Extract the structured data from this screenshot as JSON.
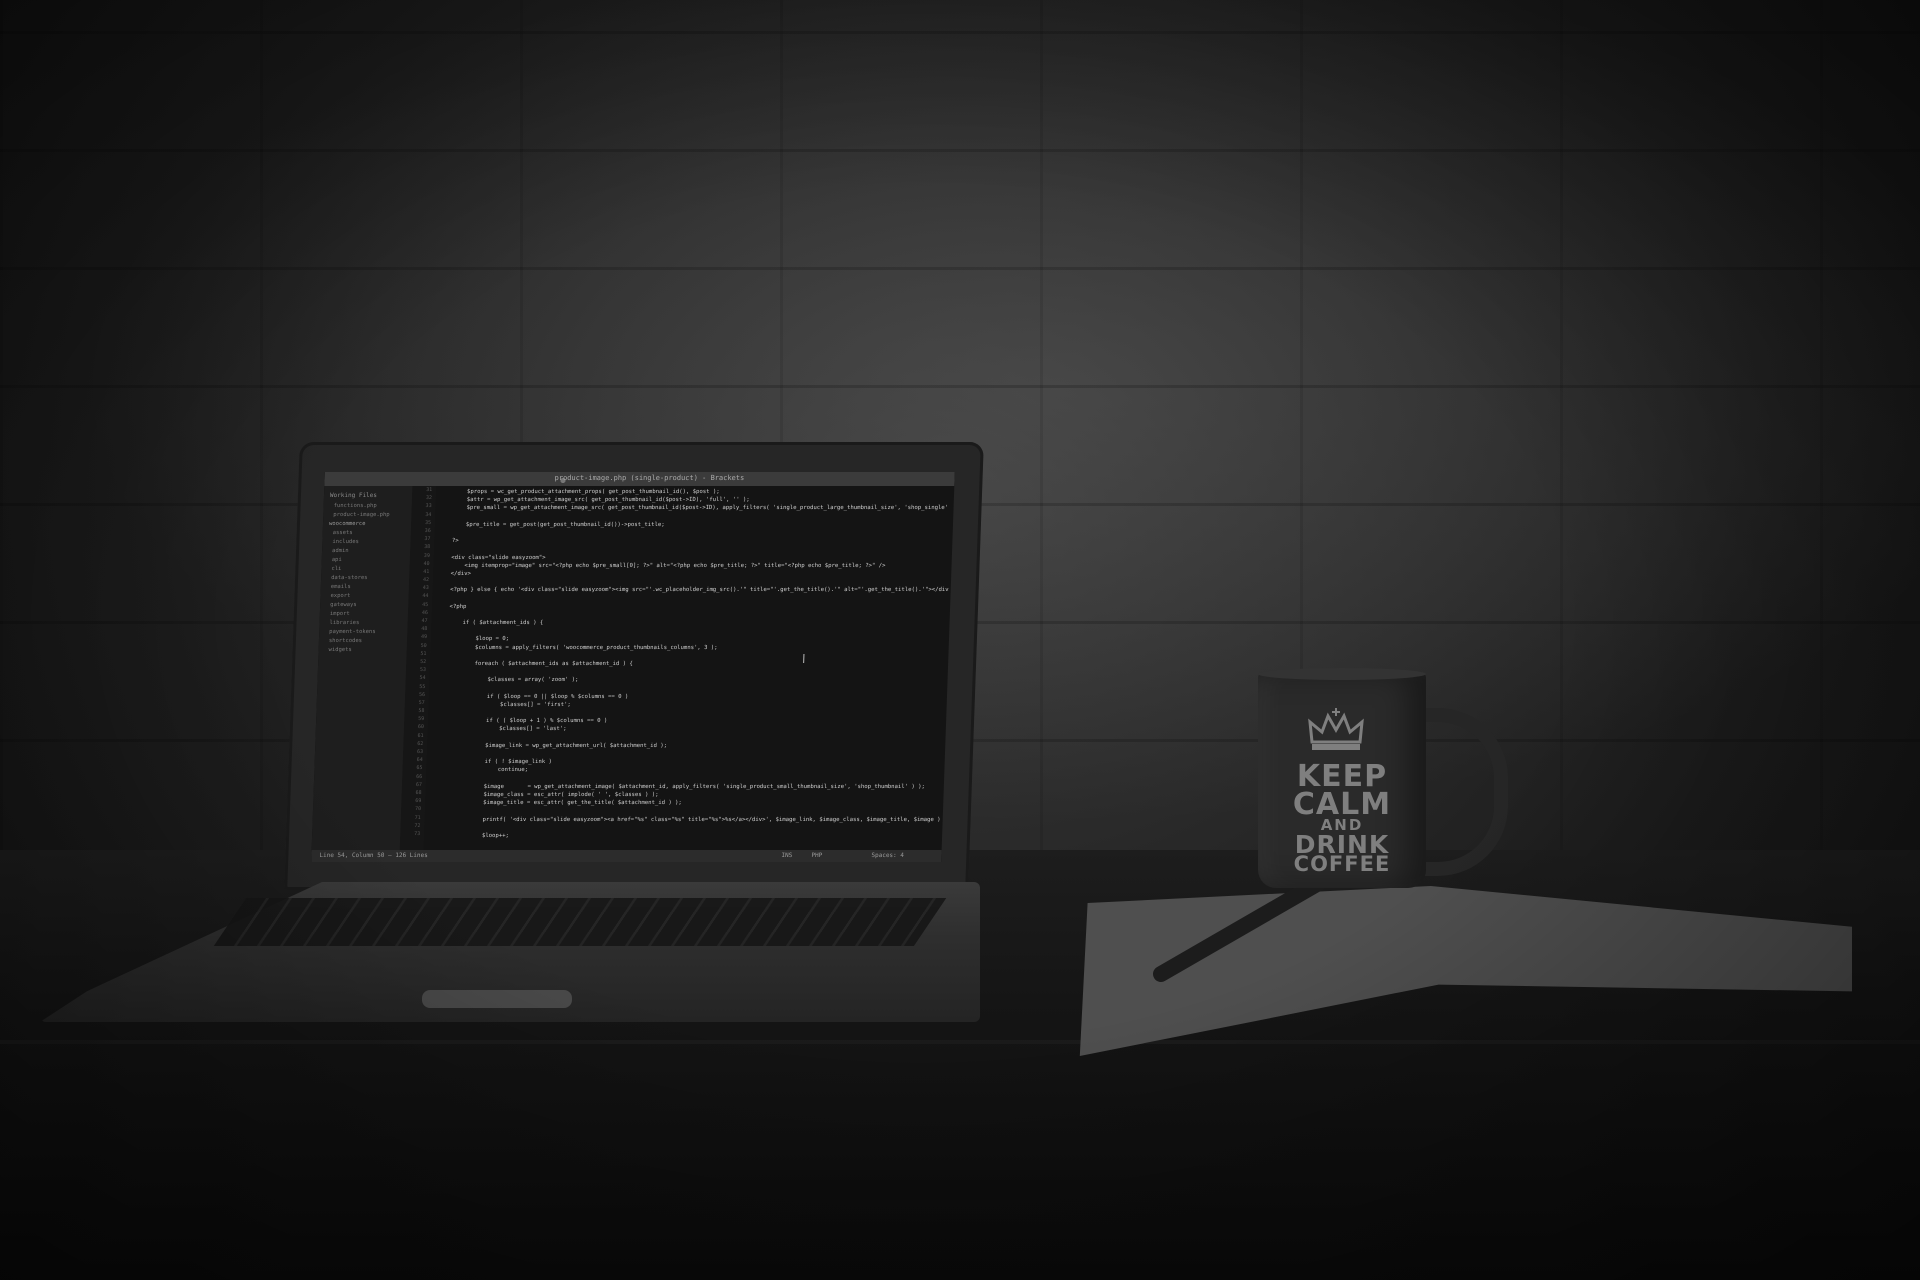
{
  "editor": {
    "title": "product-image.php (single-product) - Brackets",
    "sidebar_header": "Working Files",
    "working_files": [
      "functions.php",
      "product-image.php"
    ],
    "project_folder": "woocommerce",
    "tree": [
      "assets",
      "includes",
      "admin",
      "api",
      "cli",
      "data-stores",
      "emails",
      "export",
      "gateways",
      "import",
      "libraries",
      "payment-tokens",
      "shortcodes",
      "widgets"
    ],
    "line_numbers": [
      "31",
      "32",
      "33",
      "34",
      "35",
      "36",
      "37",
      "38",
      "39",
      "40",
      "41",
      "42",
      "43",
      "44",
      "45",
      "46",
      "47",
      "48",
      "49",
      "50",
      "51",
      "52",
      "53",
      "54",
      "55",
      "56",
      "57",
      "58",
      "59",
      "60",
      "61",
      "62",
      "63",
      "64",
      "65",
      "66",
      "67",
      "68",
      "69",
      "70",
      "71",
      "72",
      "73"
    ],
    "code_lines": [
      "        $props = wc_get_product_attachment_props( get_post_thumbnail_id(), $post );",
      "        $attr = wp_get_attachment_image_src( get_post_thumbnail_id($post->ID), 'full', '' );",
      "        $pre_small = wp_get_attachment_image_src( get_post_thumbnail_id($post->ID), apply_filters( 'single_product_large_thumbnail_size', 'shop_single' ) );",
      "",
      "        $pre_title = get_post(get_post_thumbnail_id())->post_title;",
      "",
      "    ?>",
      "",
      "    <div class=\"slide easyzoom\">",
      "        <img itemprop=\"image\" src=\"<?php echo $pre_small[0]; ?>\" alt=\"<?php echo $pre_title; ?>\" title=\"<?php echo $pre_title; ?>\" />",
      "    </div>",
      "",
      "    <?php } else { echo '<div class=\"slide easyzoom\"><img src=\"'.wc_placeholder_img_src().'\" title=\"'.get_the_title().'\" alt=\"'.get_the_title().'\"></div>'; } ?>",
      "",
      "    <?php",
      "",
      "        if ( $attachment_ids ) {",
      "",
      "            $loop = 0;",
      "            $columns = apply_filters( 'woocommerce_product_thumbnails_columns', 3 );",
      "",
      "            foreach ( $attachment_ids as $attachment_id ) {",
      "",
      "                $classes = array( 'zoom' );",
      "",
      "                if ( $loop == 0 || $loop % $columns == 0 )",
      "                    $classes[] = 'first';",
      "",
      "                if ( ( $loop + 1 ) % $columns == 0 )",
      "                    $classes[] = 'last';",
      "",
      "                $image_link = wp_get_attachment_url( $attachment_id );",
      "",
      "                if ( ! $image_link )",
      "                    continue;",
      "",
      "                $image       = wp_get_attachment_image( $attachment_id, apply_filters( 'single_product_small_thumbnail_size', 'shop_thumbnail' ) );",
      "                $image_class = esc_attr( implode( ' ', $classes ) );",
      "                $image_title = esc_attr( get_the_title( $attachment_id ) );",
      "",
      "                printf( '<div class=\"slide easyzoom\"><a href=\"%s\" class=\"%s\" title=\"%s\">%s</a></div>', $image_link, $image_class, $image_title, $image );",
      "",
      "                $loop++;"
    ],
    "status_left": "Line 54, Column 50 — 126 Lines",
    "status_right": [
      "INS",
      "PHP",
      "Spaces: 4"
    ]
  },
  "mug": {
    "line1": "KEEP",
    "line2": "CALM",
    "line3": "AND",
    "line4": "DRINK",
    "line5": "COFFEE",
    "icon": "crown-icon"
  },
  "colors": {
    "background": "#0f0f0f",
    "screen": "#141414",
    "mug": "#2a2a2a",
    "notebook": "#4f4f4f"
  }
}
